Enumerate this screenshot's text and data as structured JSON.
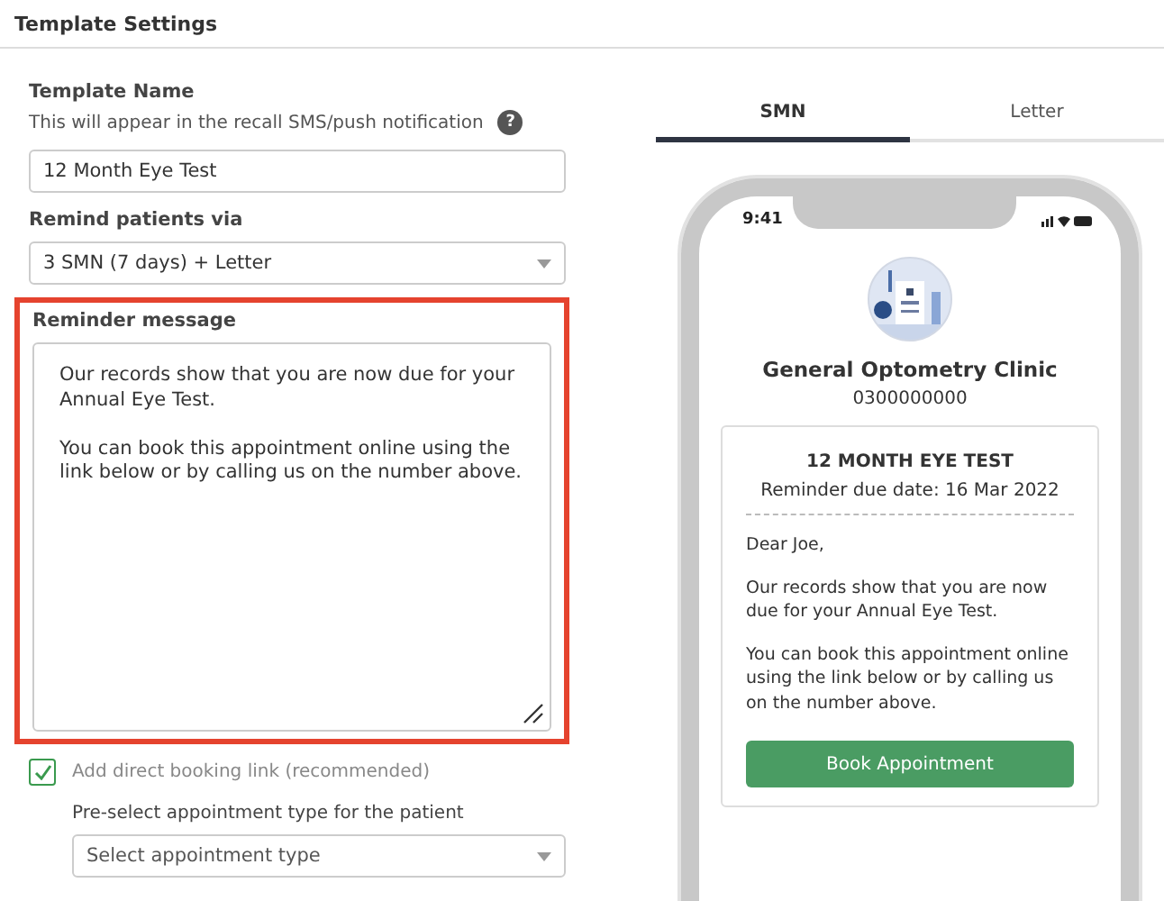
{
  "header": {
    "title": "Template Settings"
  },
  "form": {
    "name_label": "Template Name",
    "name_help": "This will appear in the recall SMS/push notification",
    "help_icon": "?",
    "name_value": "12 Month Eye Test",
    "via_label": "Remind patients via",
    "via_value": "3 SMN (7 days) + Letter",
    "message_label": "Reminder message",
    "message_highlighted": true,
    "message_value": "Our records show that you are now due for your Annual Eye Test.\n\nYou can book this appointment online using the link below or by calling us on the number above.",
    "booking_link": {
      "label": "Add direct booking link (recommended)",
      "checked": true
    },
    "type_label": "Pre-select appointment type for the patient",
    "type_placeholder": "Select appointment type"
  },
  "tabs": [
    {
      "label": "SMN",
      "selected": true
    },
    {
      "label": "Letter",
      "selected": false
    }
  ],
  "phone": {
    "time": "9:41",
    "clinic": "General Optometry Clinic",
    "number": "0300000000",
    "title": "12 MONTH EYE TEST",
    "due": "Reminder due date: 16 Mar 2022",
    "greeting": "Dear Joe,",
    "paragraphs": [
      "Our records show that you are now due for your Annual Eye Test.",
      "You can book this appointment online using the link below or by calling us on the number above."
    ],
    "button": "Book Appointment"
  }
}
